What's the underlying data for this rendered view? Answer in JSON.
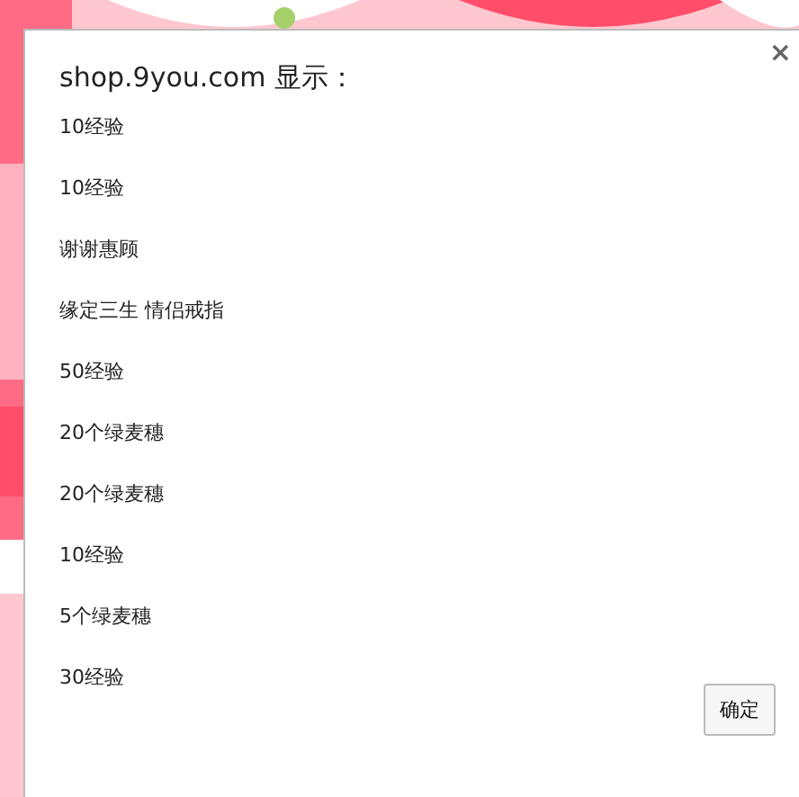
{
  "dialog": {
    "title": "shop.9you.com 显示：",
    "close": "×",
    "messages": [
      "10经验",
      "10经验",
      "谢谢惠顾",
      "缘定三生 情侣戒指",
      "50经验",
      "20个绿麦穗",
      "20个绿麦穗",
      "10经验",
      "5个绿麦穗",
      "30经验"
    ],
    "buttons": [
      "确定"
    ]
  }
}
